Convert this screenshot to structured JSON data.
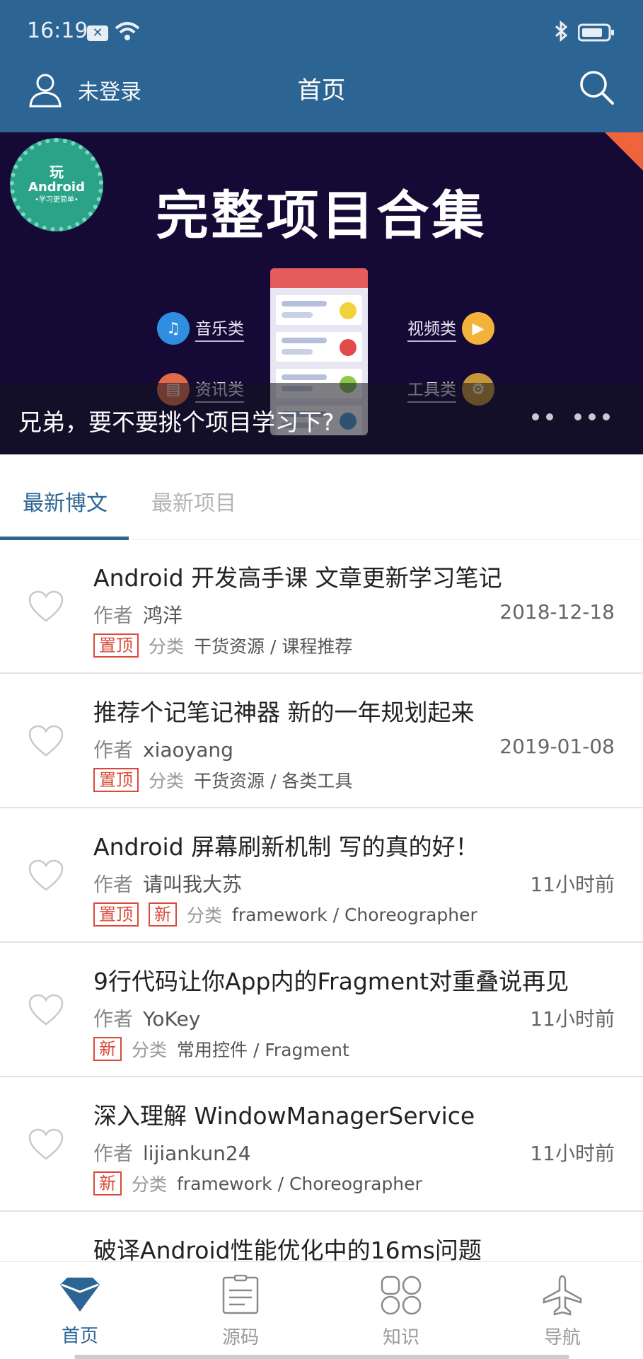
{
  "status_bar": {
    "time": "16:19",
    "x_badge": "✕",
    "icons": [
      "close-badge-icon",
      "wifi-icon",
      "bluetooth-icon",
      "battery-icon"
    ]
  },
  "header": {
    "login_label": "未登录",
    "title": "首页"
  },
  "banner": {
    "badge_line1": "玩",
    "badge_line2": "Android",
    "badge_line3": "•学习更简单•",
    "title": "完整项目合集",
    "categories": [
      "音乐类",
      "视频类",
      "资讯类",
      "工具类"
    ],
    "caption": "兄弟，要不要挑个项目学习下?",
    "page_count": 6
  },
  "tabs": [
    {
      "label": "最新博文",
      "active": true
    },
    {
      "label": "最新项目",
      "active": false
    }
  ],
  "labels": {
    "author": "作者",
    "category": "分类"
  },
  "articles": [
    {
      "title": "Android 开发高手课 文章更新学习笔记",
      "author": "鸿洋",
      "date": "2018-12-18",
      "tags": [
        "置顶"
      ],
      "category": "干货资源 / 课程推荐"
    },
    {
      "title": "推荐个记笔记神器 新的一年规划起来",
      "author": "xiaoyang",
      "date": "2019-01-08",
      "tags": [
        "置顶"
      ],
      "category": "干货资源 / 各类工具"
    },
    {
      "title": "Android 屏幕刷新机制 写的真的好！",
      "author": "请叫我大苏",
      "date": "11小时前",
      "tags": [
        "置顶",
        "新"
      ],
      "category": "framework / Choreographer"
    },
    {
      "title": "9行代码让你App内的Fragment对重叠说再见",
      "author": "YoKey",
      "date": "11小时前",
      "tags": [
        "新"
      ],
      "category": "常用控件 / Fragment"
    },
    {
      "title": "深入理解 WindowManagerService",
      "author": "lijiankun24",
      "date": "11小时前",
      "tags": [
        "新"
      ],
      "category": "framework / Choreographer"
    },
    {
      "title": "破译Android性能优化中的16ms问题",
      "author": "",
      "date": "",
      "tags": [],
      "category": ""
    }
  ],
  "bottom_nav": [
    {
      "label": "首页",
      "icon": "home-diamond-icon",
      "active": true
    },
    {
      "label": "源码",
      "icon": "clipboard-icon",
      "active": false
    },
    {
      "label": "知识",
      "icon": "grid-circles-icon",
      "active": false
    },
    {
      "label": "导航",
      "icon": "airplane-icon",
      "active": false
    }
  ],
  "colors": {
    "primary": "#2c6494",
    "tag_red": "#d94a3a",
    "banner_bg": "#150a36"
  }
}
